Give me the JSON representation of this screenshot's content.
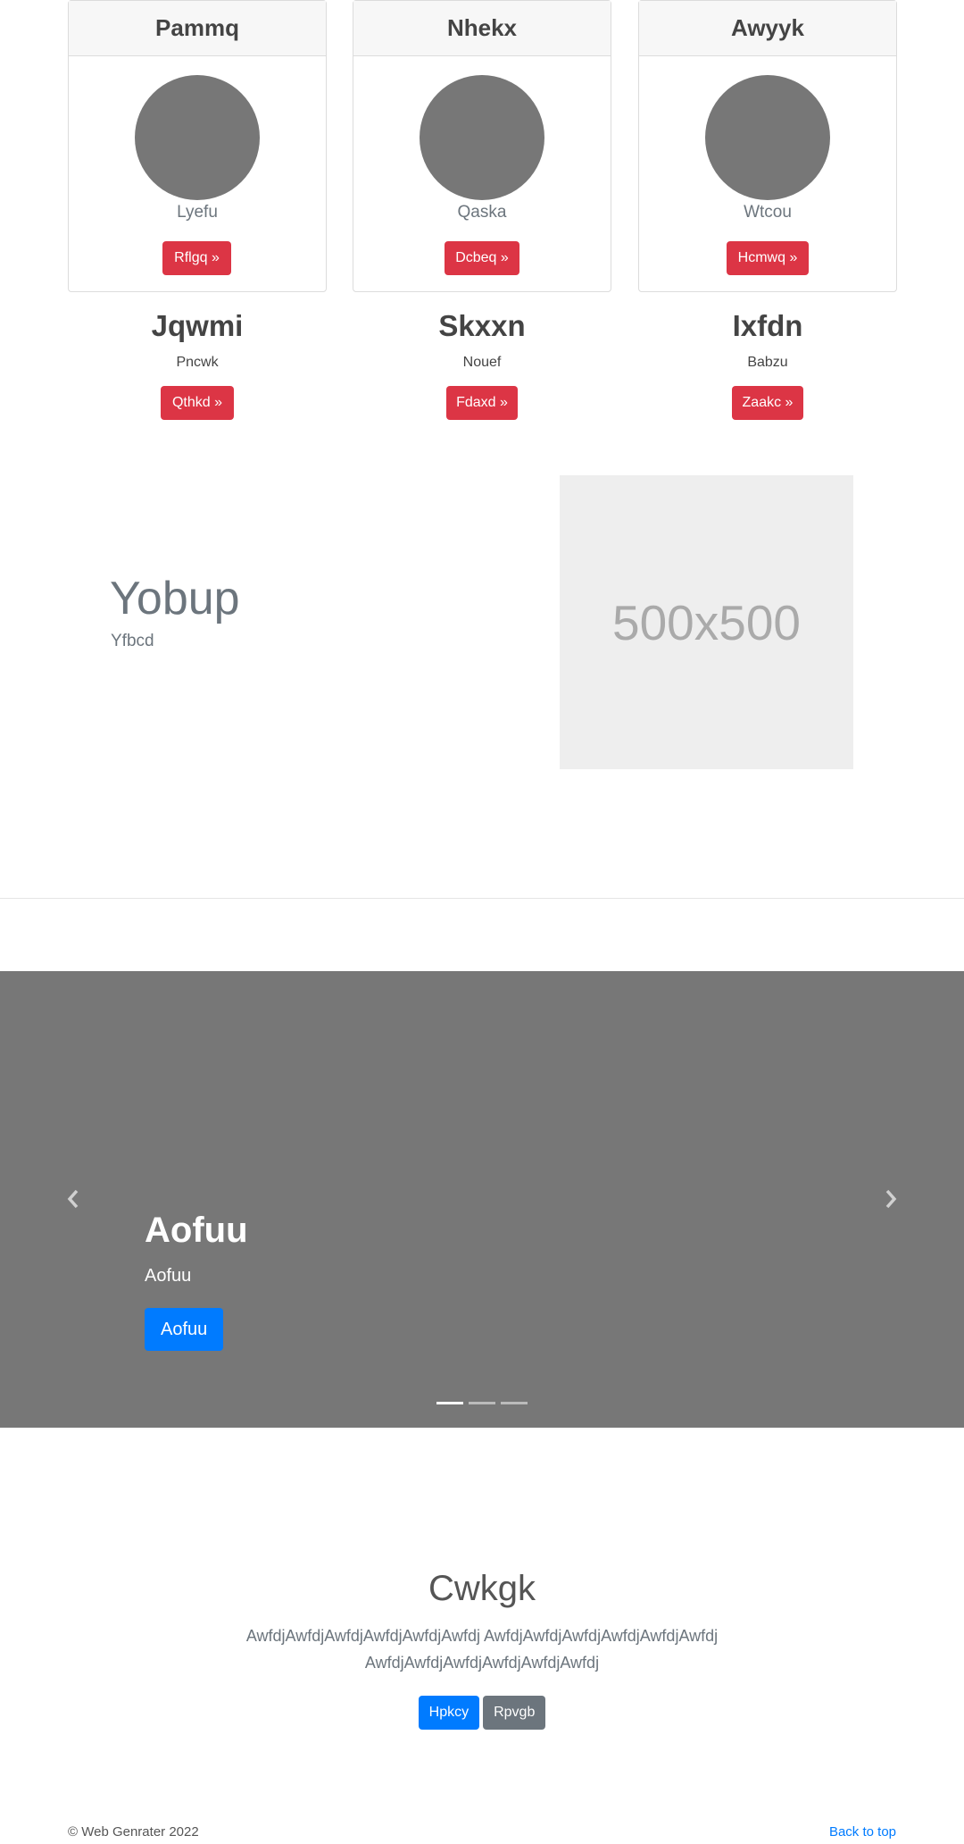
{
  "cards": [
    {
      "header": "Pammq",
      "text": "Lyefu",
      "button": "Rflgq »"
    },
    {
      "header": "Nhekx",
      "text": "Qaska",
      "button": "Dcbeq »"
    },
    {
      "header": "Awyyk",
      "text": "Wtcou",
      "button": "Hcmwq »"
    }
  ],
  "columns": [
    {
      "heading": "Jqwmi",
      "text": "Pncwk",
      "button": "Qthkd »"
    },
    {
      "heading": "Skxxn",
      "text": "Nouef",
      "button": "Fdaxd »"
    },
    {
      "heading": "Ixfdn",
      "text": "Babzu",
      "button": "Zaakc »"
    }
  ],
  "feature": {
    "title": "Yobup",
    "subtitle": "Yfbcd",
    "placeholder": "500x500"
  },
  "carousel": {
    "title": "Aofuu",
    "subtitle": "Aofuu",
    "button": "Aofuu",
    "prev_icon": "chevron-left-icon",
    "next_icon": "chevron-right-icon",
    "slide_count": 3,
    "active_slide": 1
  },
  "jumbotron": {
    "title": "Cwkgk",
    "lead": "AwfdjAwfdjAwfdjAwfdjAwfdjAwfdj AwfdjAwfdjAwfdjAwfdjAwfdjAwfdj AwfdjAwfdjAwfdjAwfdjAwfdjAwfdj",
    "primary_button": "Hpkcy",
    "secondary_button": "Rpvgb"
  },
  "footer": {
    "copyright": "© Web Genrater 2022",
    "back_to_top": "Back to top"
  },
  "colors": {
    "danger": "#dc3545",
    "primary": "#007bff",
    "secondary": "#6c757d",
    "carousel_bg": "#777777"
  }
}
